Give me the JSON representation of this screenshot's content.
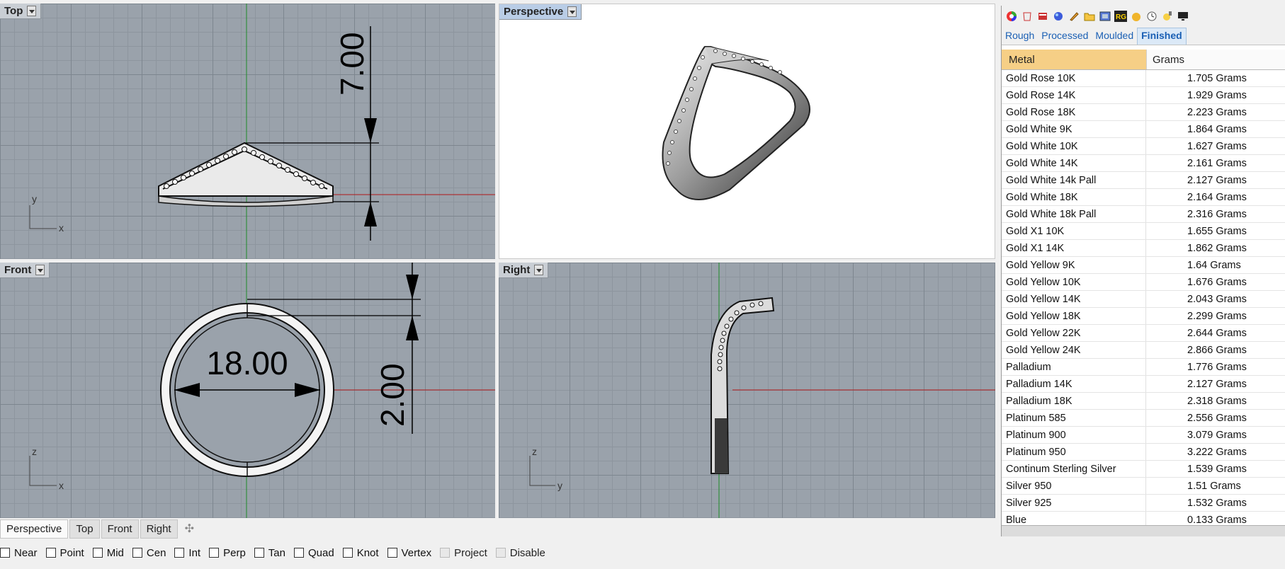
{
  "viewports": {
    "top": {
      "label": "Top"
    },
    "perspective": {
      "label": "Perspective"
    },
    "front": {
      "label": "Front"
    },
    "right": {
      "label": "Right"
    }
  },
  "dimensions": {
    "top_height": "7.00",
    "front_diameter": "18.00",
    "front_thickness": "2.00"
  },
  "axes": {
    "top": {
      "v": "y",
      "h": "x"
    },
    "front": {
      "v": "z",
      "h": "x"
    },
    "right": {
      "v": "z",
      "h": "y"
    }
  },
  "toolbar": {
    "icons": [
      "color-wheel-icon",
      "bucket-icon",
      "book-icon",
      "sphere-icon",
      "pen-icon",
      "folder-icon",
      "image-icon",
      "rg-icon",
      "ball-icon",
      "clock-icon",
      "lamp-icon",
      "monitor-icon"
    ]
  },
  "panel": {
    "tabs": [
      {
        "label": "Rough",
        "active": false
      },
      {
        "label": "Processed",
        "active": false
      },
      {
        "label": "Moulded",
        "active": false
      },
      {
        "label": "Finished",
        "active": true
      }
    ],
    "columns": {
      "metal": "Metal",
      "grams": "Grams"
    },
    "rows": [
      {
        "metal": "Gold Rose 10K",
        "grams": "1.705 Grams"
      },
      {
        "metal": "Gold Rose 14K",
        "grams": "1.929 Grams"
      },
      {
        "metal": "Gold Rose 18K",
        "grams": "2.223 Grams"
      },
      {
        "metal": "Gold White 9K",
        "grams": "1.864 Grams"
      },
      {
        "metal": "Gold White 10K",
        "grams": "1.627 Grams"
      },
      {
        "metal": "Gold White 14K",
        "grams": "2.161 Grams"
      },
      {
        "metal": "Gold White 14k Pall",
        "grams": "2.127 Grams"
      },
      {
        "metal": "Gold White 18K",
        "grams": "2.164 Grams"
      },
      {
        "metal": "Gold White 18k Pall",
        "grams": "2.316 Grams"
      },
      {
        "metal": "Gold X1 10K",
        "grams": "1.655 Grams"
      },
      {
        "metal": "Gold X1 14K",
        "grams": "1.862 Grams"
      },
      {
        "metal": "Gold Yellow 9K",
        "grams": "1.64 Grams"
      },
      {
        "metal": "Gold Yellow 10K",
        "grams": "1.676 Grams"
      },
      {
        "metal": "Gold Yellow 14K",
        "grams": "2.043 Grams"
      },
      {
        "metal": "Gold Yellow 18K",
        "grams": "2.299 Grams"
      },
      {
        "metal": "Gold Yellow 22K",
        "grams": "2.644 Grams"
      },
      {
        "metal": "Gold Yellow 24K",
        "grams": "2.866 Grams"
      },
      {
        "metal": "Palladium",
        "grams": "1.776 Grams"
      },
      {
        "metal": "Palladium 14K",
        "grams": "2.127 Grams"
      },
      {
        "metal": "Palladium 18K",
        "grams": "2.318 Grams"
      },
      {
        "metal": "Platinum 585",
        "grams": "2.556 Grams"
      },
      {
        "metal": "Platinum 900",
        "grams": "3.079 Grams"
      },
      {
        "metal": "Platinum 950",
        "grams": "3.222 Grams"
      },
      {
        "metal": "Continum Sterling Silver",
        "grams": "1.539 Grams"
      },
      {
        "metal": "Silver 950",
        "grams": "1.51 Grams"
      },
      {
        "metal": "Silver 925",
        "grams": "1.532 Grams"
      },
      {
        "metal": "Blue",
        "grams": "0.133 Grams"
      }
    ]
  },
  "bottom_tabs": [
    {
      "label": "Perspective",
      "active": true
    },
    {
      "label": "Top",
      "active": false
    },
    {
      "label": "Front",
      "active": false
    },
    {
      "label": "Right",
      "active": false
    }
  ],
  "snaps": [
    {
      "label": "Near",
      "enabled": true
    },
    {
      "label": "Point",
      "enabled": true
    },
    {
      "label": "Mid",
      "enabled": true
    },
    {
      "label": "Cen",
      "enabled": true
    },
    {
      "label": "Int",
      "enabled": true
    },
    {
      "label": "Perp",
      "enabled": true
    },
    {
      "label": "Tan",
      "enabled": true
    },
    {
      "label": "Quad",
      "enabled": true
    },
    {
      "label": "Knot",
      "enabled": true
    },
    {
      "label": "Vertex",
      "enabled": true
    },
    {
      "label": "Project",
      "enabled": false
    },
    {
      "label": "Disable",
      "enabled": false
    }
  ]
}
